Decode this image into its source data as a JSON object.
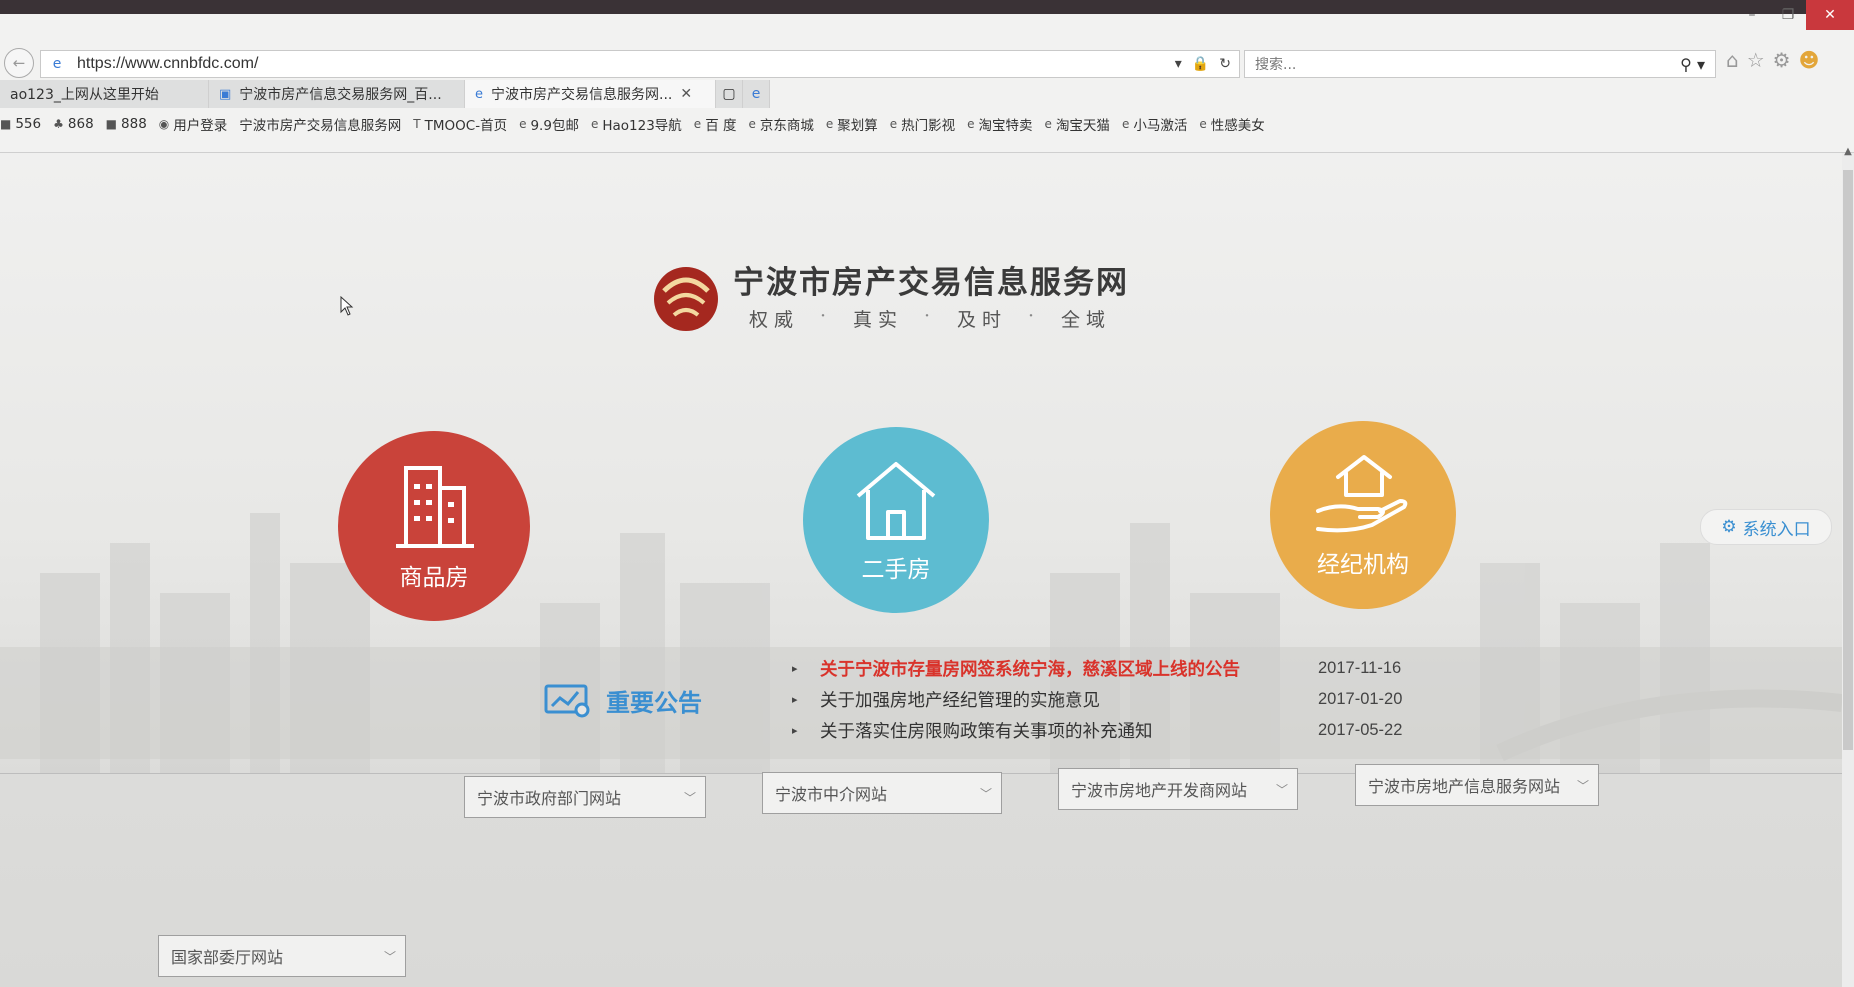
{
  "browser": {
    "url": "https://www.cnnbfdc.com/",
    "search_placeholder": "搜索...",
    "tabs": [
      {
        "label": "ao123_上网从这里开始",
        "icon": ""
      },
      {
        "label": "宁波市房产信息交易服务网_百...",
        "icon": "sogou-icon"
      },
      {
        "label": "宁波市房产交易信息服务网...",
        "icon": "ie-icon",
        "active": true,
        "close": "✕"
      }
    ],
    "favorites": [
      {
        "label": "556",
        "icon": "■"
      },
      {
        "label": "868",
        "icon": "♣"
      },
      {
        "label": "888",
        "icon": "■"
      },
      {
        "label": "用户登录",
        "icon": "◉"
      },
      {
        "label": "宁波市房产交易信息服务网",
        "icon": ""
      },
      {
        "label": "TMOOC-首页",
        "icon": "T"
      },
      {
        "label": "9.9包邮",
        "icon": "e"
      },
      {
        "label": "Hao123导航",
        "icon": "e"
      },
      {
        "label": "百 度",
        "icon": "e"
      },
      {
        "label": "京东商城",
        "icon": "e"
      },
      {
        "label": "聚划算",
        "icon": "e"
      },
      {
        "label": "热门影视",
        "icon": "e"
      },
      {
        "label": "淘宝特卖",
        "icon": "e"
      },
      {
        "label": "淘宝天猫",
        "icon": "e"
      },
      {
        "label": "小马激活",
        "icon": "e"
      },
      {
        "label": "性感美女",
        "icon": "e"
      }
    ]
  },
  "site": {
    "title": "宁波市房产交易信息服务网",
    "slogan": [
      "权 威",
      "真 实",
      "及 时",
      "全 域"
    ]
  },
  "categories": [
    {
      "label": "商品房",
      "color": "#c9433a",
      "icon": "building-icon"
    },
    {
      "label": "二手房",
      "color": "#5dbcd1",
      "icon": "house-icon"
    },
    {
      "label": "经纪机构",
      "color": "#e9ac4b",
      "icon": "hand-house-icon"
    }
  ],
  "system_entry": "系统入口",
  "notices": {
    "title": "重要公告",
    "items": [
      {
        "text": "关于宁波市存量房网签系统宁海，慈溪区域上线的公告",
        "date": "2017-11-16",
        "highlight": true
      },
      {
        "text": "关于加强房地产经纪管理的实施意见",
        "date": "2017-01-20",
        "highlight": false
      },
      {
        "text": "关于落实住房限购政策有关事项的补充通知",
        "date": "2017-05-22",
        "highlight": false
      }
    ]
  },
  "link_selects": [
    "国家部委厅网站",
    "宁波市政府部门网站",
    "宁波市中介网站",
    "宁波市房地产开发商网站",
    "宁波市房地产信息服务网站"
  ]
}
